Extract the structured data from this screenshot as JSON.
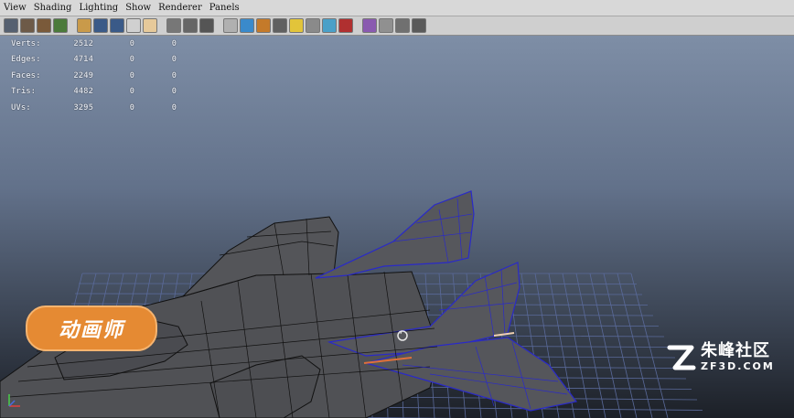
{
  "menu": {
    "items": [
      "View",
      "Shading",
      "Lighting",
      "Show",
      "Renderer",
      "Panels"
    ]
  },
  "toolbar": {
    "buttons": [
      {
        "icon": "select-camera-icon",
        "color": "#556070"
      },
      {
        "icon": "lock-camera-icon",
        "color": "#6d5a48"
      },
      {
        "icon": "bookmark-icon",
        "color": "#7a5a3a"
      },
      {
        "icon": "image-plane-icon",
        "color": "#4b7a3a"
      },
      {
        "sep": true
      },
      {
        "icon": "grid-icon",
        "color": "#c99a4a"
      },
      {
        "icon": "film-gate-icon",
        "color": "#3a5a88"
      },
      {
        "icon": "resolution-gate-icon",
        "color": "#3a5a88"
      },
      {
        "icon": "gate-mask-icon",
        "color": "#d0d0d0"
      },
      {
        "icon": "field-chart-icon",
        "color": "#e6c99a"
      },
      {
        "sep": true
      },
      {
        "icon": "safe-action-icon",
        "color": "#777777"
      },
      {
        "icon": "safe-title-icon",
        "color": "#666666"
      },
      {
        "icon": "film-origin-icon",
        "color": "#555555"
      },
      {
        "sep": true
      },
      {
        "icon": "wireframe-icon",
        "color": "#b0b0b0"
      },
      {
        "icon": "smooth-shade-icon",
        "color": "#3a8acb"
      },
      {
        "icon": "wireframe-on-shaded-icon",
        "color": "#c47a2a"
      },
      {
        "icon": "textured-icon",
        "color": "#606060"
      },
      {
        "icon": "use-lights-icon",
        "color": "#e2c43a"
      },
      {
        "icon": "shadows-icon",
        "color": "#8a8a8a"
      },
      {
        "icon": "screen-space-ao-icon",
        "color": "#4aa0c8"
      },
      {
        "icon": "motion-blur-icon",
        "color": "#b03030"
      },
      {
        "sep": true
      },
      {
        "icon": "isolate-select-icon",
        "color": "#8a5ab0"
      },
      {
        "icon": "xray-icon",
        "color": "#909090"
      },
      {
        "icon": "xray-joints-icon",
        "color": "#707070"
      },
      {
        "icon": "xray-active-icon",
        "color": "#5a5a5a"
      }
    ]
  },
  "hud": {
    "rows": [
      {
        "label": "Verts:",
        "v1": "2512",
        "v2": "0",
        "v3": "0"
      },
      {
        "label": "Edges:",
        "v1": "4714",
        "v2": "0",
        "v3": "0"
      },
      {
        "label": "Faces:",
        "v1": "2249",
        "v2": "0",
        "v3": "0"
      },
      {
        "label": "Tris:",
        "v1": "4482",
        "v2": "0",
        "v3": "0"
      },
      {
        "label": "UVs:",
        "v1": "3295",
        "v2": "0",
        "v3": "0"
      }
    ]
  },
  "viewport": {
    "mesh_fill": "#505155",
    "wire_color": "#111111",
    "selected_wire_color": "#2a2ac8",
    "grid_color": "#5a6a9a"
  },
  "overlays": {
    "logo_text": "动画师",
    "logo_color": "#e58a33",
    "watermark_cn": "朱峰社区",
    "watermark_en": "ZF3D.COM"
  }
}
